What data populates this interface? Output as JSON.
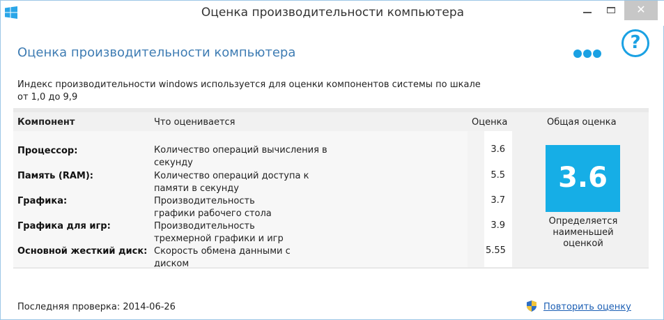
{
  "window": {
    "title": "Оценка производительности компьютера",
    "close_glyph": "✕"
  },
  "header": {
    "heading": "Оценка производительности компьютера",
    "help_glyph": "?",
    "description": "Индекс производительности windows используется для оценки компонентов системы по шкале от 1,0 до 9,9"
  },
  "table": {
    "columns": {
      "component": "Компонент",
      "what": "Что оценивается",
      "score": "Оценка",
      "overall": "Общая оценка"
    },
    "rows": [
      {
        "name": "Процессор:",
        "desc": "Количество операций вычисления в секунду",
        "score": "3.6"
      },
      {
        "name": "Память (RAM):",
        "desc": "Количество операций доступа к памяти в секунду",
        "score": "5.5"
      },
      {
        "name": "Графика:",
        "desc": "Производительность графики рабочего стола",
        "score": "3.7"
      },
      {
        "name": "Графика для игр:",
        "desc": "Производительность трехмерной графики и игр",
        "score": "3.9"
      },
      {
        "name": "Основной жесткий диск:",
        "desc": "Скорость обмена данными с диском",
        "score": "5.55"
      }
    ],
    "overall_score": "3.6",
    "overall_note": "Определяется наименьшей оценкой"
  },
  "footer": {
    "last_check": "Последняя проверка: 2014-06-26",
    "repeat_link": "Повторить оценку"
  },
  "colors": {
    "accent": "#16aee6",
    "heading": "#3e7cb3",
    "link": "#1c5fb4"
  }
}
